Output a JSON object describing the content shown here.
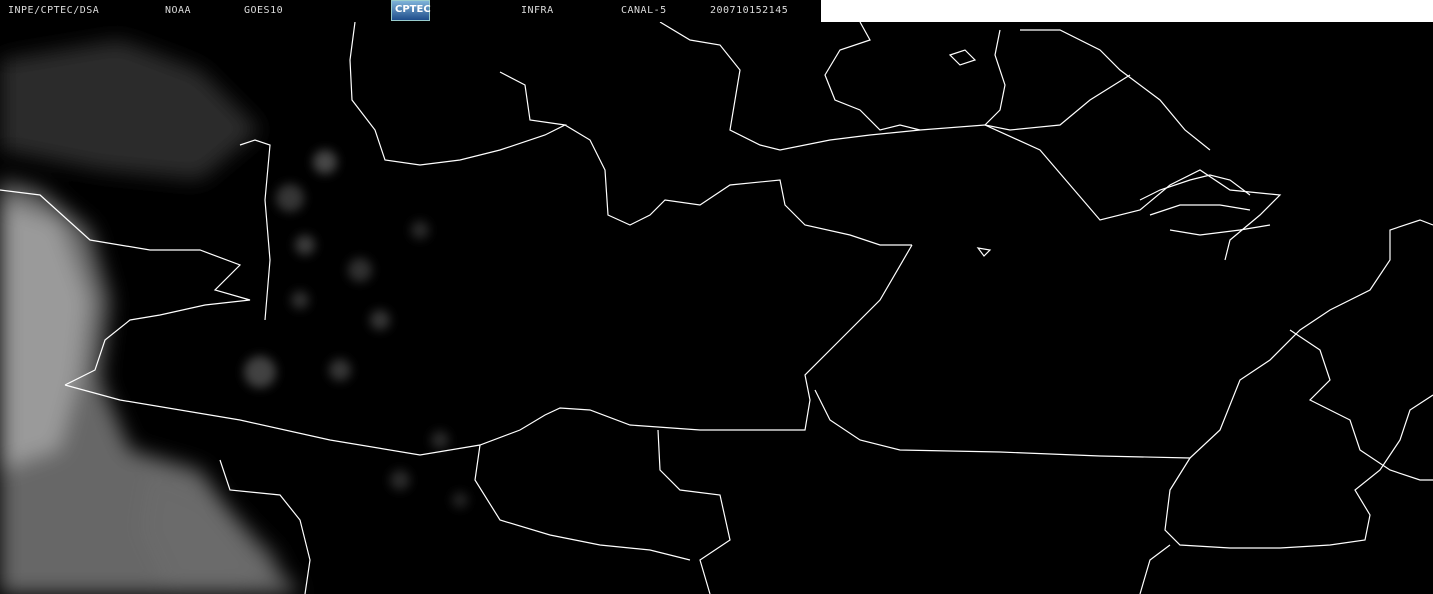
{
  "header": {
    "source": "INPE/CPTEC/DSA",
    "agency": "NOAA",
    "satellite": "GOES10",
    "logo_text": "CPTEC",
    "band": "INFRA",
    "channel": "CANAL-5",
    "datetime": "200710152145"
  },
  "colors": {
    "background": "#000000",
    "borders": "#ffffff",
    "clouds": "#bfbfbf"
  }
}
